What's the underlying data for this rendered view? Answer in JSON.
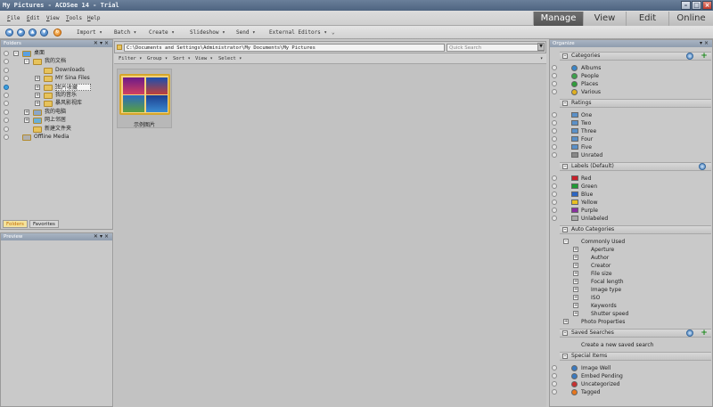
{
  "window": {
    "title": "My Pictures - ACDSee 14 - Trial"
  },
  "menu": [
    "File",
    "Edit",
    "View",
    "Tools",
    "Help"
  ],
  "modes": [
    {
      "label": "Manage",
      "active": true
    },
    {
      "label": "View",
      "active": false
    },
    {
      "label": "Edit",
      "active": false
    },
    {
      "label": "Online",
      "active": false
    }
  ],
  "toolbar": {
    "items": [
      "Import ▾",
      "Batch ▾",
      "Create ▾",
      "Slideshow ▾",
      "Send ▾",
      "External Editors ▾"
    ]
  },
  "folders_panel": {
    "title": "Folders",
    "tree": [
      {
        "label": "桌面",
        "indent": 0,
        "expander": "-",
        "icon": "desktop"
      },
      {
        "label": "我的文档",
        "indent": 1,
        "expander": "-",
        "icon": "folder"
      },
      {
        "label": "Downloads",
        "indent": 2,
        "expander": "",
        "icon": "folder"
      },
      {
        "label": "MY Sina Files",
        "indent": 2,
        "expander": "+",
        "icon": "folder"
      },
      {
        "label": "图片收藏",
        "indent": 2,
        "expander": "+",
        "icon": "folder",
        "selected": true
      },
      {
        "label": "我的音乐",
        "indent": 2,
        "expander": "+",
        "icon": "folder"
      },
      {
        "label": "暴风影视库",
        "indent": 2,
        "expander": "+",
        "icon": "folder"
      },
      {
        "label": "我的电脑",
        "indent": 1,
        "expander": "+",
        "icon": "computer"
      },
      {
        "label": "网上邻居",
        "indent": 1,
        "expander": "+",
        "icon": "network"
      },
      {
        "label": "新建文件夹",
        "indent": 1,
        "expander": "",
        "icon": "folder"
      },
      {
        "label": "Offline Media",
        "indent": 0,
        "expander": "",
        "icon": "offline"
      }
    ],
    "tabs": [
      {
        "label": "Folders",
        "active": true
      },
      {
        "label": "Favorites",
        "active": false
      }
    ]
  },
  "preview_panel": {
    "title": "Preview"
  },
  "path": {
    "value": "C:\\Documents and Settings\\Administrator\\My Documents\\My Pictures",
    "search_placeholder": "Quick Search"
  },
  "filter_bar": [
    "Filter ▾",
    "Group ▾",
    "Sort ▾",
    "View ▾",
    "Select ▾"
  ],
  "files": [
    {
      "name": "示例图片"
    }
  ],
  "organize": {
    "title": "Organize",
    "sections": [
      {
        "label": "Categories",
        "rows": [
          {
            "label": "Albums",
            "icon": "albums-icon",
            "color": "#3a86c8"
          },
          {
            "label": "People",
            "icon": "people-icon",
            "color": "#3aa24a"
          },
          {
            "label": "Places",
            "icon": "places-icon",
            "color": "#2f9e3b"
          },
          {
            "label": "Various",
            "icon": "various-icon",
            "color": "#e0b020"
          }
        ]
      },
      {
        "label": "Ratings",
        "rows": [
          {
            "label": "One",
            "icon": "rating-1-icon",
            "color": "#5a90c8"
          },
          {
            "label": "Two",
            "icon": "rating-2-icon",
            "color": "#5a90c8"
          },
          {
            "label": "Three",
            "icon": "rating-3-icon",
            "color": "#5a90c8"
          },
          {
            "label": "Four",
            "icon": "rating-4-icon",
            "color": "#5a90c8"
          },
          {
            "label": "Five",
            "icon": "rating-5-icon",
            "color": "#5a90c8"
          },
          {
            "label": "Unrated",
            "icon": "unrated-icon",
            "color": "#888888"
          }
        ]
      },
      {
        "label": "Labels (Default)",
        "rows": [
          {
            "label": "Red",
            "icon": "label-red-swatch",
            "color": "#c8202a"
          },
          {
            "label": "Green",
            "icon": "label-green-swatch",
            "color": "#1f9b35"
          },
          {
            "label": "Blue",
            "icon": "label-blue-swatch",
            "color": "#2b66c4"
          },
          {
            "label": "Yellow",
            "icon": "label-yellow-swatch",
            "color": "#e8c020"
          },
          {
            "label": "Purple",
            "icon": "label-purple-swatch",
            "color": "#8a2ea0"
          },
          {
            "label": "Unlabeled",
            "icon": "label-none-swatch",
            "color": "#a8a8a8"
          }
        ]
      },
      {
        "label": "Auto Categories",
        "rows": [
          {
            "label": "Commonly Used",
            "tree": "-"
          },
          {
            "label": "Aperture",
            "tree": "+"
          },
          {
            "label": "Author",
            "tree": "+"
          },
          {
            "label": "Creator",
            "tree": "+"
          },
          {
            "label": "File size",
            "tree": "+"
          },
          {
            "label": "Focal length",
            "tree": "+"
          },
          {
            "label": "Image type",
            "tree": "+"
          },
          {
            "label": "ISO",
            "tree": "+"
          },
          {
            "label": "Keywords",
            "tree": "+"
          },
          {
            "label": "Shutter speed",
            "tree": "+"
          },
          {
            "label": "Photo Properties",
            "tree": "+"
          }
        ]
      },
      {
        "label": "Saved Searches",
        "rows": [
          {
            "label": "Create a new saved search"
          }
        ]
      },
      {
        "label": "Special Items",
        "rows": [
          {
            "label": "Image Well",
            "icon": "image-well-icon",
            "color": "#3a7ac0"
          },
          {
            "label": "Embed Pending",
            "icon": "embed-pending-icon",
            "color": "#3a7ac0"
          },
          {
            "label": "Uncategorized",
            "icon": "uncategorized-icon",
            "color": "#c83030"
          },
          {
            "label": "Tagged",
            "icon": "tagged-icon",
            "color": "#e8761c"
          }
        ]
      }
    ]
  }
}
